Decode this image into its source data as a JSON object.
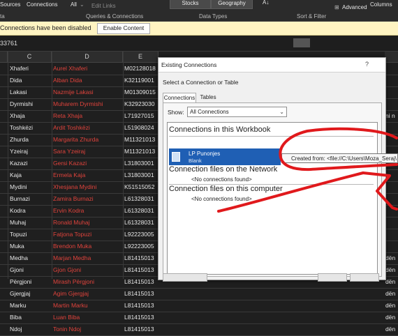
{
  "ribbon": {
    "sources_label": "Sources",
    "connections_label": "Connections",
    "all_label": "All",
    "edit_links_label": "Edit Links",
    "queries_group_label": "Queries & Connections",
    "data_label": "ta",
    "stocks_label": "Stocks",
    "geography_label": "Geography",
    "data_types_label": "Data Types",
    "sort_filter_label": "Sort & Filter",
    "advanced_label": "Advanced",
    "columns_label": "Columns"
  },
  "message_bar": {
    "text": "Connections have been disabled",
    "button": "Enable Content"
  },
  "formula_bar": {
    "cell_ref": "33761"
  },
  "columns": [
    "C",
    "D",
    "E"
  ],
  "rows": [
    {
      "c": "Xhaferi",
      "d": "Aurel Xhaferi",
      "e": "M02128018",
      "extra": ""
    },
    {
      "c": "Dida",
      "d": "Alban Dida",
      "e": "K32119001",
      "extra": ""
    },
    {
      "c": "Lakasi",
      "d": "Nazmije Lakasi",
      "e": "M01309015",
      "extra": ""
    },
    {
      "c": "Dyrmishi",
      "d": "Muharem Dyrmishi",
      "e": "K32923030",
      "extra": ""
    },
    {
      "c": "Xhaja",
      "d": "Reta Xhaja",
      "e": "L71927015",
      "extra": "ni n"
    },
    {
      "c": "Toshkëzi",
      "d": "Ardit Toshkëzi",
      "e": "L51908024",
      "extra": ""
    },
    {
      "c": "Zhurda",
      "d": "Margarita Zhurda",
      "e": "M11321013",
      "extra": ""
    },
    {
      "c": "Yzeiraj",
      "d": "Sara Yzeiraj",
      "e": "M11321013",
      "extra": ""
    },
    {
      "c": "Kazazi",
      "d": "Gersi Kazazi",
      "e": "L31803001",
      "extra": ""
    },
    {
      "c": "Kaja",
      "d": "Ermela Kaja",
      "e": "L31803001",
      "extra": ""
    },
    {
      "c": "Mydini",
      "d": "Xhesjana Mydini",
      "e": "K51515052",
      "extra": ""
    },
    {
      "c": "Burnazi",
      "d": "Zamira Burnazi",
      "e": "L61328031",
      "extra": ""
    },
    {
      "c": "Kodra",
      "d": "Ervin Kodra",
      "e": "L61328031",
      "extra": ""
    },
    {
      "c": "Muhaj",
      "d": "Ronald Muhaj",
      "e": "L61328031",
      "extra": ""
    },
    {
      "c": "Topuzi",
      "d": "Fatjona Topuzi",
      "e": "L92223005",
      "extra": ""
    },
    {
      "c": "Muka",
      "d": "Brendon Muka",
      "e": "L92223005",
      "extra": ""
    },
    {
      "c": "Medha",
      "d": "Marjan Medha",
      "e": "L81415013",
      "extra": "dën"
    },
    {
      "c": "Gjoni",
      "d": "Gjon Gjoni",
      "e": "L81415013",
      "extra": "dën"
    },
    {
      "c": "Përgjoni",
      "d": "Mirash Përgjoni",
      "e": "L81415013",
      "extra": "dën"
    },
    {
      "c": "Gjergjaj",
      "d": "Agim Gjergjaj",
      "e": "L81415013",
      "extra": "dën"
    },
    {
      "c": "Marku",
      "d": "Martin Marku",
      "e": "L81415013",
      "extra": "dën"
    },
    {
      "c": "Biba",
      "d": "Luan Biba",
      "e": "L81415013",
      "extra": "dën"
    },
    {
      "c": "Ndoj",
      "d": "Tonin Ndoj",
      "e": "L81415013",
      "extra": "dën"
    }
  ],
  "dialog": {
    "title": "Existing Connections",
    "help": "?",
    "subtitle": "Select a Connection or Table",
    "tab_connections": "Connections",
    "tab_tables": "Tables",
    "show_label": "Show:",
    "show_value": "All Connections",
    "section_workbook": "Connections in this Workbook",
    "connection_name": "LP Punonjes",
    "connection_desc": "Blank",
    "section_network": "Connection files on the Network",
    "no_connections_network": "<No connections found>",
    "section_computer": "Connection files on this computer",
    "no_connections_computer": "<No connections found>",
    "tooltip": "Created from: <file://C:\\Users\\Moza_Seraj\\"
  },
  "colors": {
    "accent_selected": "#1f5fb4",
    "message_bar": "#fff4c2",
    "annotation": "#e0191c",
    "name_text": "#e0433c"
  }
}
